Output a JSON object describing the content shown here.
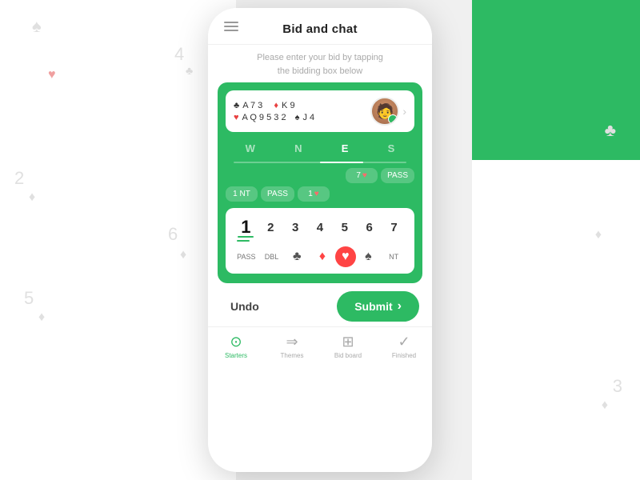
{
  "background": {
    "decos": [
      {
        "symbol": "♠",
        "class": "deco-spade-tl"
      },
      {
        "symbol": "4",
        "class": "deco-4-tr"
      },
      {
        "symbol": "♣",
        "class": "deco-4-club"
      },
      {
        "symbol": "2",
        "class": "deco-2-l"
      },
      {
        "symbol": "♦",
        "class": "deco-diamond-l2"
      },
      {
        "symbol": "6",
        "class": "deco-6-bl"
      },
      {
        "symbol": "♦",
        "class": "deco-diamond-bl"
      },
      {
        "symbol": "5",
        "class": "deco-5-bot"
      },
      {
        "symbol": "♦",
        "class": "deco-diamond-bot"
      },
      {
        "symbol": "♣",
        "class": "deco-club-r1"
      },
      {
        "symbol": "♦",
        "class": "deco-diamond-r1"
      },
      {
        "symbol": "3",
        "class": "deco-3-br"
      },
      {
        "symbol": "♦",
        "class": "deco-diamond-br"
      },
      {
        "symbol": "♥",
        "class": "deco-heart-tl"
      }
    ]
  },
  "header": {
    "title": "Bid and chat",
    "subtitle_line1": "Please enter your bid by tapping",
    "subtitle_line2": "the bidding box below"
  },
  "hand": {
    "line1_suit": "♣",
    "line1_cards": "A 7 3",
    "line1_suit2": "♦",
    "line1_cards2": "K 9",
    "line2_suit": "♥",
    "line2_cards": "A Q 9 5 3 2",
    "line2_suit2": "♠",
    "line2_cards2": "J 4"
  },
  "directions": {
    "tabs": [
      "W",
      "N",
      "E",
      "S"
    ],
    "active": "E"
  },
  "bids": {
    "row1": [
      {
        "label": "7 ♥",
        "type": "heart"
      },
      {
        "label": "PASS",
        "type": "pass"
      }
    ],
    "row2": [
      {
        "label": "1 NT",
        "type": "nt"
      },
      {
        "label": "PASS",
        "type": "pass"
      },
      {
        "label": "1 ♥",
        "type": "heart"
      }
    ]
  },
  "numpad": {
    "numbers": [
      "1",
      "2",
      "3",
      "4",
      "5",
      "6",
      "7"
    ],
    "selected_number": "1",
    "suits": [
      "PASS",
      "DBL",
      "♣",
      "♦",
      "♥",
      "♠",
      "NT"
    ],
    "selected_suit_index": 4
  },
  "actions": {
    "undo": "Undo",
    "submit": "Submit"
  },
  "nav": {
    "items": [
      {
        "label": "Starters",
        "icon": "⊙",
        "active": true
      },
      {
        "label": "Themes",
        "icon": "→"
      },
      {
        "label": "Bid board",
        "icon": "⊞"
      },
      {
        "label": "Finished",
        "icon": "✓"
      }
    ]
  }
}
